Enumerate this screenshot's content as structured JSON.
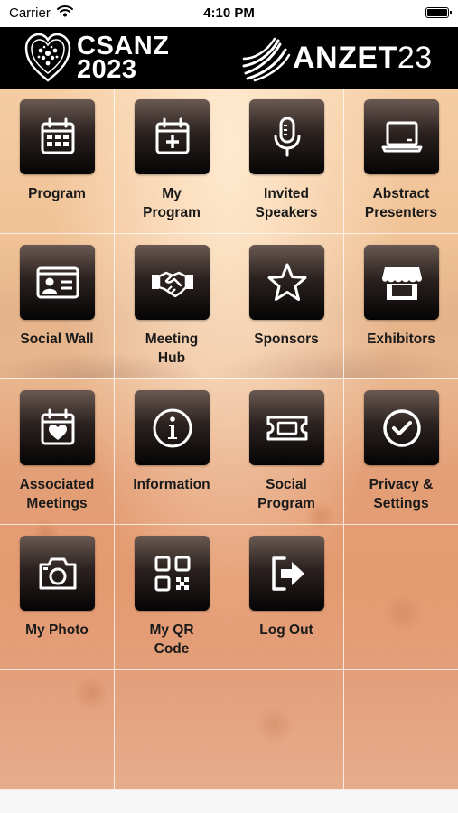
{
  "status_bar": {
    "carrier": "Carrier",
    "time": "4:10 PM"
  },
  "header": {
    "left_logo": {
      "line1": "CSANZ",
      "line2": "2023"
    },
    "right_logo": {
      "bold": "ANZET",
      "light": "23"
    }
  },
  "menu": [
    {
      "label": "Program",
      "icon": "calendar-icon"
    },
    {
      "label": "My\nProgram",
      "icon": "calendar-plus-icon"
    },
    {
      "label": "Invited\nSpeakers",
      "icon": "microphone-icon"
    },
    {
      "label": "Abstract\nPresenters",
      "icon": "presentation-icon"
    },
    {
      "label": "Social Wall",
      "icon": "id-card-icon"
    },
    {
      "label": "Meeting\nHub",
      "icon": "handshake-icon"
    },
    {
      "label": "Sponsors",
      "icon": "star-icon"
    },
    {
      "label": "Exhibitors",
      "icon": "storefront-icon"
    },
    {
      "label": "Associated\nMeetings",
      "icon": "calendar-heart-icon"
    },
    {
      "label": "Information",
      "icon": "info-icon"
    },
    {
      "label": "Social\nProgram",
      "icon": "ticket-icon"
    },
    {
      "label": "Privacy &\nSettings",
      "icon": "check-circle-icon"
    },
    {
      "label": "My Photo",
      "icon": "camera-icon"
    },
    {
      "label": "My QR\nCode",
      "icon": "qr-code-icon"
    },
    {
      "label": "Log Out",
      "icon": "logout-icon"
    }
  ]
}
